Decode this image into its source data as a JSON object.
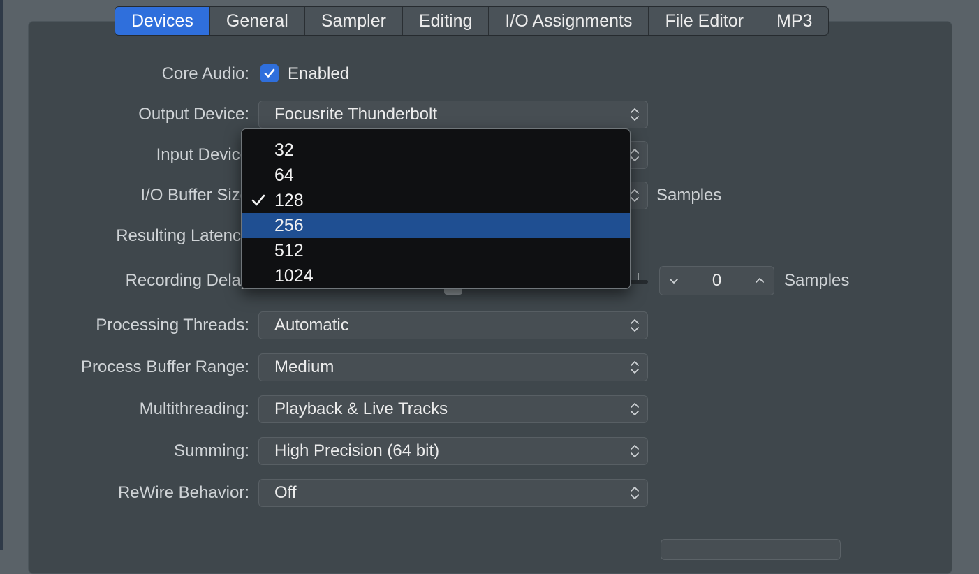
{
  "tabs": [
    "Devices",
    "General",
    "Sampler",
    "Editing",
    "I/O Assignments",
    "File Editor",
    "MP3"
  ],
  "labels": {
    "core_audio": "Core Audio:",
    "output_device": "Output Device:",
    "input_device": "Input Device",
    "io_buffer_size": "I/O Buffer Size",
    "resulting_latency": "Resulting Latency",
    "recording_delay": "Recording Delay",
    "processing_threads": "Processing Threads:",
    "process_buffer_range": "Process Buffer Range:",
    "multithreading": "Multithreading:",
    "summing": "Summing:",
    "rewire_behavior": "ReWire Behavior:"
  },
  "core_audio_enabled": "Enabled",
  "values": {
    "output_device": "Focusrite Thunderbolt",
    "processing_threads": "Automatic",
    "process_buffer_range": "Medium",
    "multithreading": "Playback & Live Tracks",
    "summing": "High Precision (64 bit)",
    "rewire_behavior": "Off"
  },
  "units": {
    "buffer": "Samples",
    "delay": "Samples"
  },
  "recording_delay_value": "0",
  "buffer_menu": {
    "options": [
      "32",
      "64",
      "128",
      "256",
      "512",
      "1024"
    ],
    "checked": "128",
    "highlighted": "256"
  },
  "colors": {
    "accent": "#2f6fdc",
    "highlight": "#1f4f92",
    "panel": "#3f474c"
  },
  "icons": [
    "checkmark-icon",
    "up-down-arrows-icon",
    "chevron-up-icon",
    "chevron-down-icon"
  ]
}
